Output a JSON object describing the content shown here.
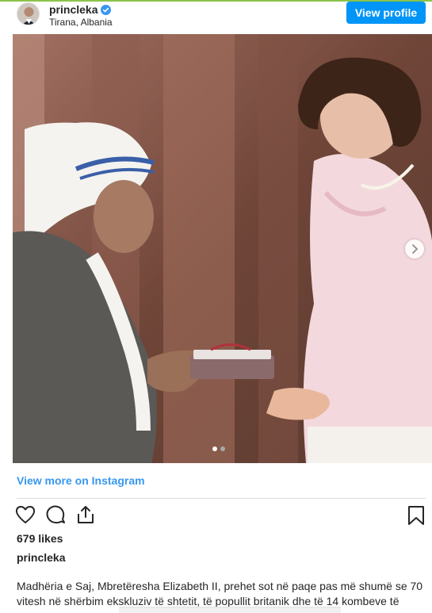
{
  "header": {
    "username": "princleka",
    "location": "Tirana, Albania",
    "view_profile_label": "View profile",
    "verified": true
  },
  "post": {
    "image_alt_subject": "Mother Teresa and Queen Elizabeth II",
    "carousel": {
      "current": 1,
      "total": 2
    }
  },
  "view_more_label": "View more on Instagram",
  "actions": {
    "icons": [
      "heart-icon",
      "comment-icon",
      "share-icon",
      "bookmark-icon"
    ]
  },
  "likes_text": "679 likes",
  "caption": {
    "username": "princleka",
    "text": "Madhëria e Saj, Mbretëresha Elizabeth II, prehet sot në paqe pas më shumë se 70 vitesh në shërbim ekskluziv të shtetit, të popullit britanik dhe të 14 kombeve të"
  },
  "colors": {
    "accent": "#0095f6",
    "link": "#3897f0",
    "text": "#262626",
    "top_bar": "#8bc34a"
  }
}
